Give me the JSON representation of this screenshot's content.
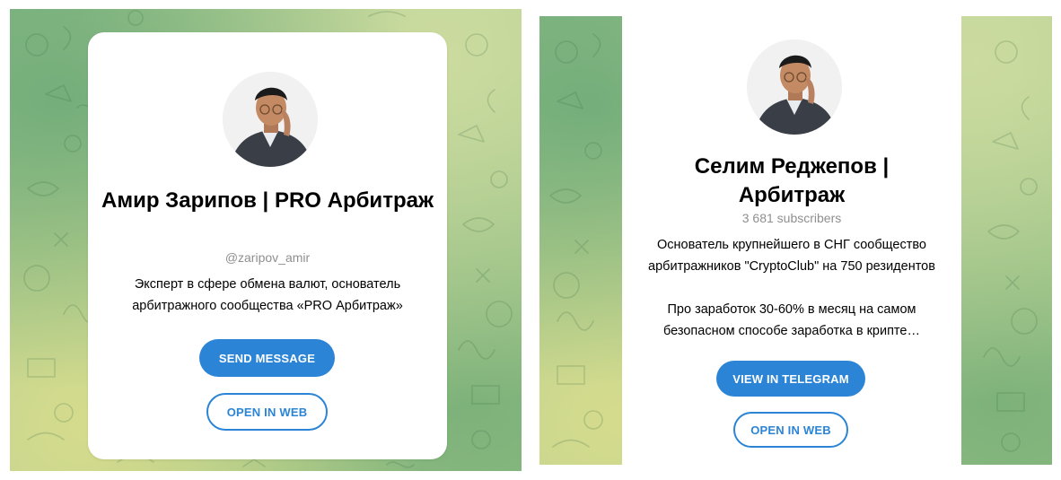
{
  "left_card": {
    "title": "Амир Зарипов | PRO Арбитраж",
    "username": "@zaripov_amir",
    "description": "Эксперт в сфере обмена валют, основатель\nарбитражного сообщества «PRO Арбитраж»",
    "primary_button": "SEND MESSAGE",
    "secondary_button": "OPEN IN WEB"
  },
  "right_card": {
    "title": "Селим Реджепов |\nАрбитраж",
    "subscribers": "3 681 subscribers",
    "description": "Основатель крупнейшего в СНГ сообщество\nарбитражников \"CryptoClub\" на 750 резидентов\n\nПро заработок 30-60% в месяц на самом\nбезопасном способе заработка в крипте…",
    "primary_button": "VIEW IN TELEGRAM",
    "secondary_button": "OPEN IN WEB"
  },
  "colors": {
    "accent": "#2b84d6",
    "muted_text": "#8f8f8f",
    "background_green": "#9cc487"
  },
  "icons": [
    "avatar-photo",
    "doodle-pattern"
  ]
}
